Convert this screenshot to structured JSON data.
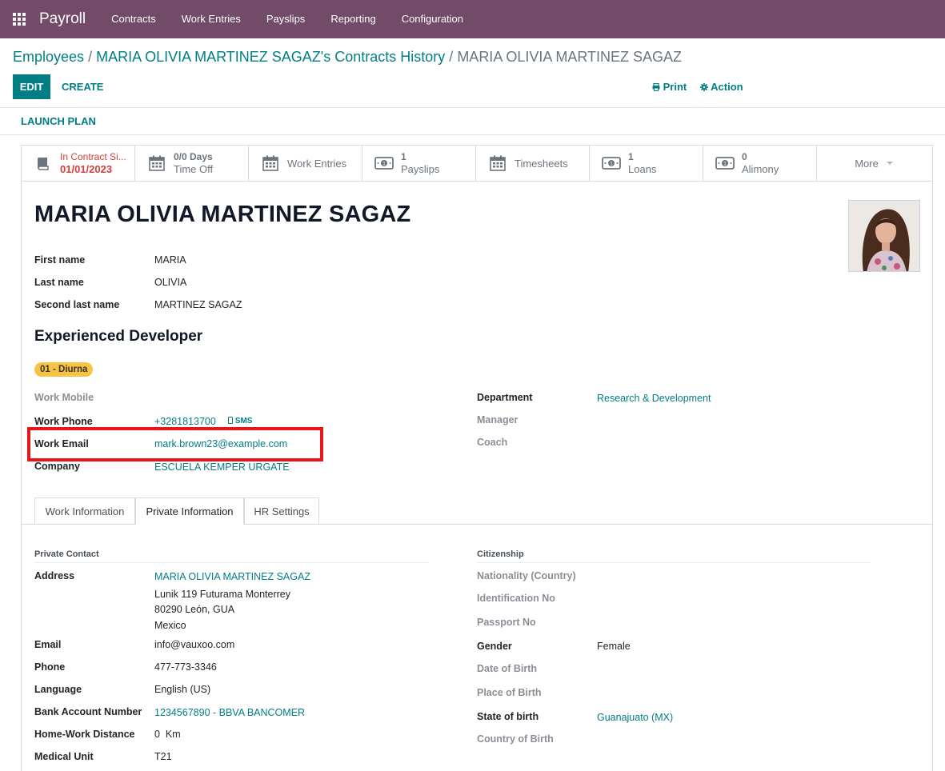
{
  "navbar": {
    "app_name": "Payroll",
    "menu": [
      "Contracts",
      "Work Entries",
      "Payslips",
      "Reporting",
      "Configuration"
    ]
  },
  "breadcrumb": {
    "items": [
      "Employees",
      "MARIA OLIVIA MARTINEZ SAGAZ's Contracts History"
    ],
    "current": "MARIA OLIVIA MARTINEZ SAGAZ"
  },
  "toolbar": {
    "edit": "EDIT",
    "create": "CREATE",
    "print": "Print",
    "action": "Action",
    "launch_plan": "LAUNCH PLAN"
  },
  "smart_buttons": [
    {
      "value": "In Contract Si...",
      "label": "01/01/2023",
      "icon": "book-icon"
    },
    {
      "value": "0/0 Days",
      "label": "Time Off",
      "icon": "calendar-icon"
    },
    {
      "label": "Work Entries",
      "icon": "calendar-icon"
    },
    {
      "value": "1",
      "label": "Payslips",
      "icon": "money-icon"
    },
    {
      "label": "Timesheets",
      "icon": "calendar-icon"
    },
    {
      "value": "1",
      "label": "Loans",
      "icon": "money-icon"
    },
    {
      "value": "0",
      "label": "Alimony",
      "icon": "money-icon"
    },
    {
      "label": "More"
    }
  ],
  "employee": {
    "name": "MARIA OLIVIA MARTINEZ SAGAZ",
    "first_name_label": "First name",
    "first_name": "MARIA",
    "last_name_label": "Last name",
    "last_name": "OLIVIA",
    "second_last_name_label": "Second last name",
    "second_last_name": "MARTINEZ SAGAZ",
    "job_title": "Experienced Developer",
    "tag": "01 - Diurna"
  },
  "work": {
    "mobile_label": "Work Mobile",
    "phone_label": "Work Phone",
    "phone": "+3281813700",
    "sms": "SMS",
    "email_label": "Work Email",
    "email": "mark.brown23@example.com",
    "company_label": "Company",
    "company": "ESCUELA KEMPER URGATE",
    "department_label": "Department",
    "department": "Research & Development",
    "manager_label": "Manager",
    "coach_label": "Coach"
  },
  "tabs": [
    "Work Information",
    "Private Information",
    "HR Settings"
  ],
  "private": {
    "section": "Private Contact",
    "address_label": "Address",
    "address_name": "MARIA OLIVIA MARTINEZ SAGAZ",
    "address_line1": "Lunik 119 Futurama Monterrey",
    "address_line2": "80290 León, GUA",
    "address_line3": "Mexico",
    "email_label": "Email",
    "email": "info@vauxoo.com",
    "phone_label": "Phone",
    "phone": "477-773-3346",
    "language_label": "Language",
    "language": "English (US)",
    "bank_label": "Bank Account Number",
    "bank": "1234567890 - BBVA BANCOMER",
    "distance_label": "Home-Work Distance",
    "distance": "0",
    "distance_unit": "Km",
    "medical_label": "Medical Unit",
    "medical": "T21"
  },
  "citizenship": {
    "section": "Citizenship",
    "nationality_label": "Nationality (Country)",
    "identification_label": "Identification No",
    "passport_label": "Passport No",
    "gender_label": "Gender",
    "gender": "Female",
    "dob_label": "Date of Birth",
    "pob_label": "Place of Birth",
    "state_label": "State of birth",
    "state": "Guanajuato (MX)",
    "country_label": "Country of Birth"
  },
  "colors": {
    "navbar": "#714b67",
    "primary": "#017e84",
    "tag": "#f6c342",
    "highlight": "#e8151b",
    "danger": "#d23f3a"
  }
}
